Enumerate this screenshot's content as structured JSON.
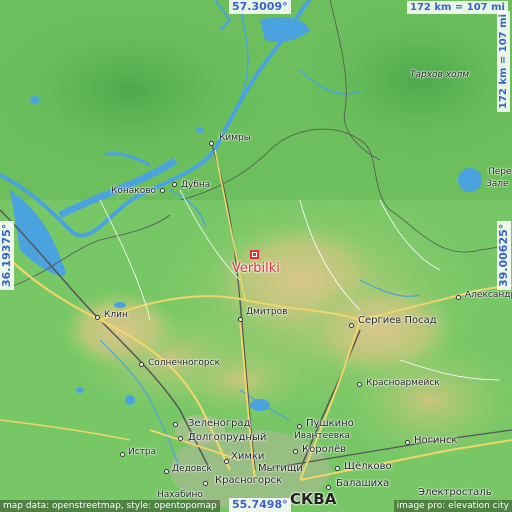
{
  "coordinates": {
    "top": "57.3009°",
    "bottom": "55.7498°",
    "left": "36.19375°",
    "right": "39.00625°"
  },
  "scale": {
    "horizontal": "172 km = 107 mi",
    "vertical": "172 km = 107 mi"
  },
  "focus_place": {
    "name": "Verbilki"
  },
  "places": [
    {
      "id": "kimry",
      "name": "Кимры"
    },
    {
      "id": "dubna",
      "name": "Дубна"
    },
    {
      "id": "konakovo",
      "name": "Конаково"
    },
    {
      "id": "dmitrov",
      "name": "Дмитров"
    },
    {
      "id": "klin",
      "name": "Клин"
    },
    {
      "id": "solnechnogorsk",
      "name": "Солнечногорск"
    },
    {
      "id": "sergiev-posad",
      "name": "Сергиев Посад"
    },
    {
      "id": "aleksandrov",
      "name": "Александр"
    },
    {
      "id": "pereslavl",
      "name": "Пере"
    },
    {
      "id": "zalesye",
      "name": "Зале"
    },
    {
      "id": "krasnoarmeysk",
      "name": "Красноармейск"
    },
    {
      "id": "zelenograd",
      "name": "Зеленоград"
    },
    {
      "id": "dolgoprudny",
      "name": "Долгопрудный"
    },
    {
      "id": "pushkino",
      "name": "Пушкино"
    },
    {
      "id": "ivanteevka",
      "name": "Ивантеевка"
    },
    {
      "id": "korolyov",
      "name": "Королёв"
    },
    {
      "id": "khimki",
      "name": "Химки"
    },
    {
      "id": "mytishchi",
      "name": "Мытищи"
    },
    {
      "id": "istra",
      "name": "Истра"
    },
    {
      "id": "dedovsk",
      "name": "Дедовск"
    },
    {
      "id": "shchyolkovo",
      "name": "Щёлково"
    },
    {
      "id": "noginsk",
      "name": "Ногинск"
    },
    {
      "id": "krasnogorsk",
      "name": "Красногорск"
    },
    {
      "id": "balashikha",
      "name": "Балашиха"
    },
    {
      "id": "elektrostal",
      "name": "Электросталь"
    },
    {
      "id": "nakhabino",
      "name": "Нахабино"
    },
    {
      "id": "moskva",
      "name": "СКВА"
    },
    {
      "id": "tarkhov-kholm",
      "name": "Тархов холм"
    }
  ],
  "attribution": {
    "left": "map data: openstreetmap, style: opentopomap",
    "right": "image pro: elevation city"
  }
}
